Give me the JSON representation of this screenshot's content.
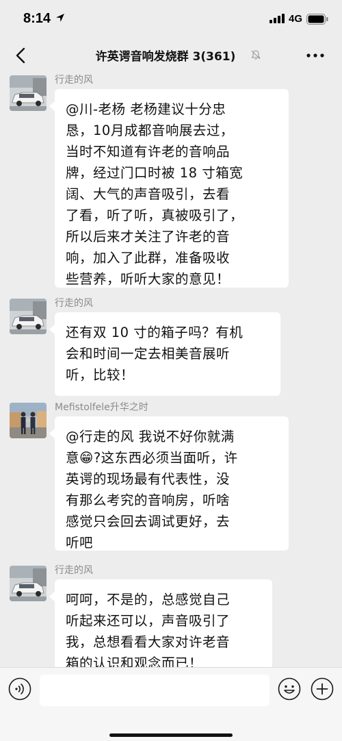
{
  "status_bar": {
    "time": "8:14",
    "network": "4G"
  },
  "header": {
    "title": "许英谔音响发烧群 3(361)",
    "back_icon": "chevron-left-icon",
    "mute_icon": "bell-muted-icon",
    "more_icon": "ellipsis-icon"
  },
  "messages": [
    {
      "sender": "行走的风",
      "avatar": "car-avatar",
      "lines": [
        "@川-老杨 老杨建议十分忠",
        "恳，10月成都音响展去过，",
        "当时不知道有许老的音响品",
        "牌，经过门口时被 18 寸箱宽",
        "阔、大气的声音吸引，去看",
        "了看，听了听，真被吸引了，",
        "所以后来才关注了许老的音",
        "响，加入了此群，准备吸收",
        "些营养，听听大家的意见！"
      ]
    },
    {
      "sender": "行走的风",
      "avatar": "car-avatar",
      "lines": [
        "还有双 10 寸的箱子吗？有机",
        "会和时间一定去相美音展听",
        "听，比较！"
      ]
    },
    {
      "sender": "Mefistolfele升华之时",
      "avatar": "people-avatar",
      "lines": [
        "@行走的风 我说不好你就满",
        "意😁?这东西必须当面听，许",
        "英谔的现场最有代表性，没",
        "有那么考究的音响房，听啥",
        "感觉只会回去调试更好，去",
        "听吧"
      ]
    },
    {
      "sender": "行走的风",
      "avatar": "car-avatar",
      "lines": [
        "呵呵，不是的，总感觉自己",
        "听起来还可以，声音吸引了",
        "我，总想看看大家对许老音",
        "箱的认识和观念而已！"
      ]
    }
  ],
  "input_bar": {
    "voice_icon": "voice-icon",
    "emoji_icon": "emoji-icon",
    "plus_icon": "plus-icon",
    "value": ""
  },
  "colors": {
    "background": "#ededed",
    "bubble": "#ffffff",
    "sender_text": "#8a8a8a"
  }
}
